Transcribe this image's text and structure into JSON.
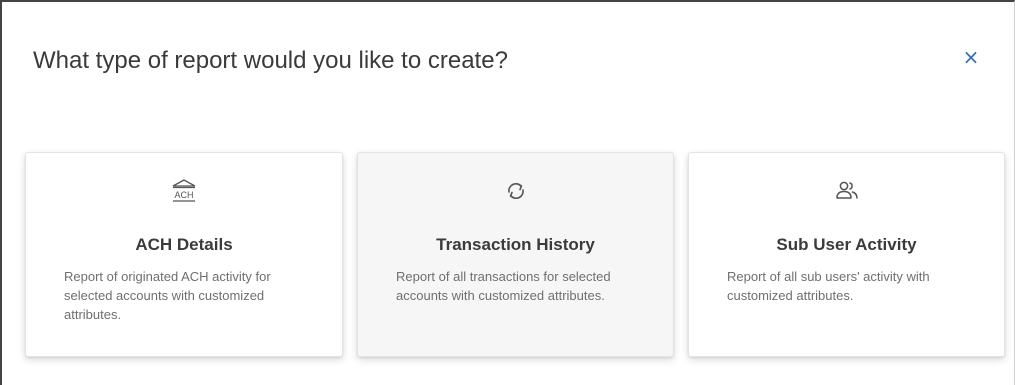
{
  "dialog": {
    "title": "What type of report would you like to create?",
    "close_label": "×"
  },
  "cards": [
    {
      "icon": "bank-ach-icon",
      "icon_text": "ACH",
      "title": "ACH Details",
      "description": "Report of originated ACH activity for selected accounts with customized attributes."
    },
    {
      "icon": "refresh-icon",
      "title": "Transaction History",
      "description": "Report of all transactions for selected accounts with customized attributes."
    },
    {
      "icon": "users-icon",
      "title": "Sub User Activity",
      "description": "Report of all sub users' activity with customized attributes."
    }
  ],
  "colors": {
    "accent": "#2f6db5",
    "title_text": "#3a3a3a",
    "body_text": "#6f6f6f",
    "icon": "#555555"
  }
}
